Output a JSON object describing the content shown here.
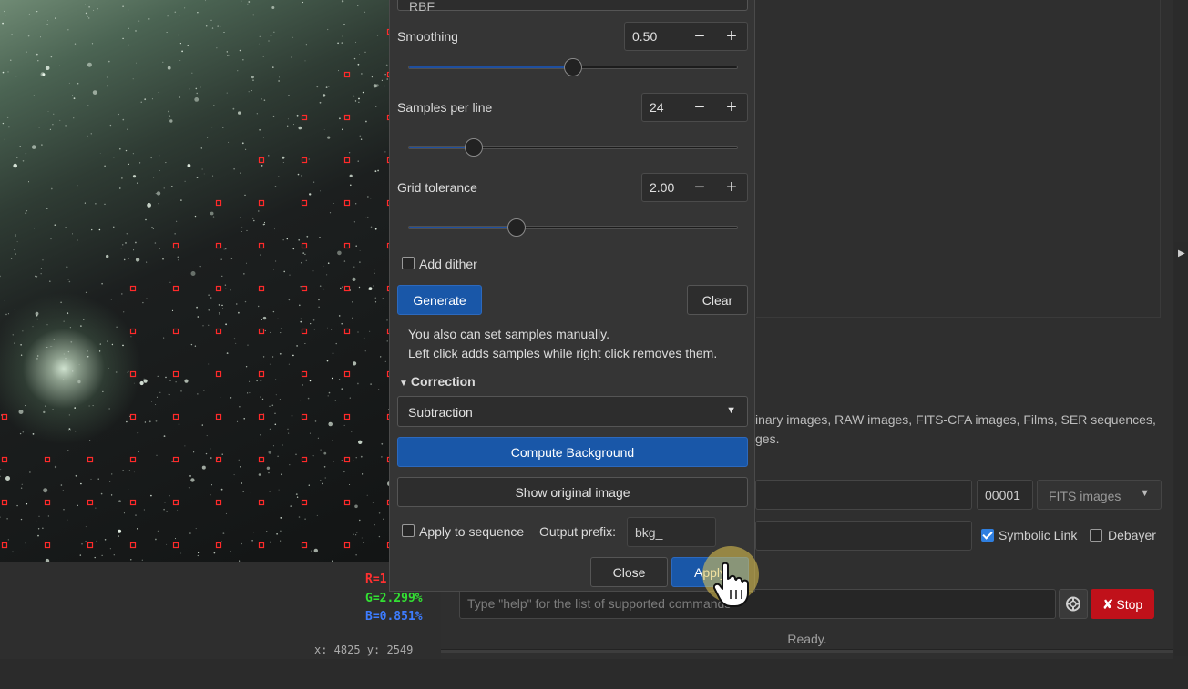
{
  "viewer": {
    "rgb_r": "R=1",
    "rgb_g": "G=2.299%",
    "rgb_b": "B=0.851%",
    "coords": "x: 4825 y: 2549",
    "sample_color": "#ff2a2a"
  },
  "dialog": {
    "top_combo_partial": "RBF",
    "smoothing": {
      "label": "Smoothing",
      "value": "0.50",
      "fraction": 0.5
    },
    "samples_per_line": {
      "label": "Samples per line",
      "value": "24",
      "fraction": 0.2
    },
    "grid_tolerance": {
      "label": "Grid tolerance",
      "value": "2.00",
      "fraction": 0.33
    },
    "add_dither": {
      "label": "Add dither",
      "checked": false
    },
    "generate_label": "Generate",
    "clear_label": "Clear",
    "info_line1": "You also can set samples manually.",
    "info_line2": "Left click adds samples while right click removes them.",
    "correction_header": "Correction",
    "correction_method": "Subtraction",
    "compute_label": "Compute Background",
    "show_original_label": "Show original image",
    "apply_to_sequence": {
      "label": "Apply to sequence",
      "checked": false
    },
    "output_prefix_label": "Output prefix:",
    "output_prefix_value": "bkg_",
    "close_label": "Close",
    "apply_label": "Apply"
  },
  "right": {
    "file_info_line1": "inary images, RAW images, FITS-CFA images, Films, SER sequences,",
    "file_info_line2": "ges.",
    "index_value": "00001",
    "format_select": "FITS images",
    "symbolic_link": {
      "label": "Symbolic Link",
      "checked": true
    },
    "debayer": {
      "label": "Debayer",
      "checked": false
    }
  },
  "command": {
    "placeholder": "Type \"help\" for the list of supported commands",
    "stop_label": "Stop",
    "status": "Ready."
  },
  "colors": {
    "accent_blue": "#1957a8",
    "stop_red": "#c0111a"
  }
}
